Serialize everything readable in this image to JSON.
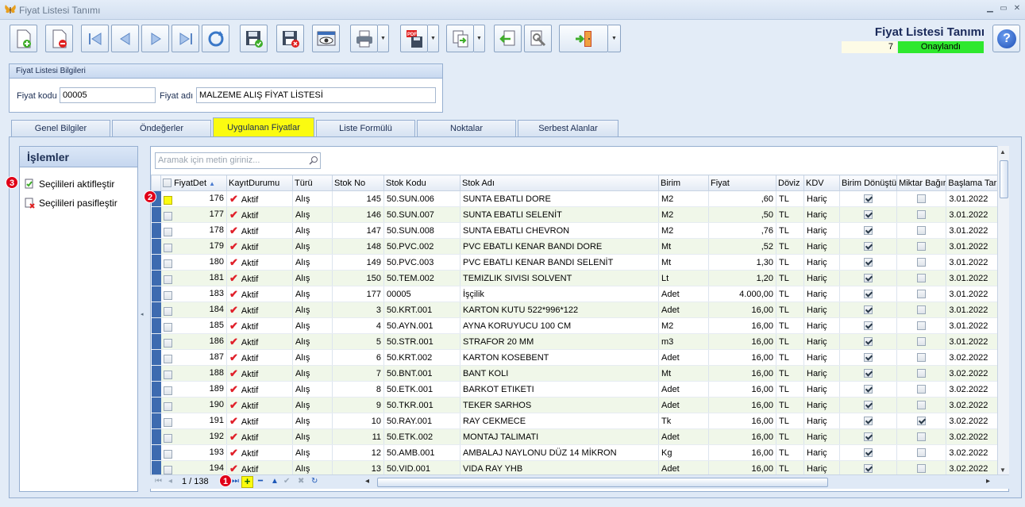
{
  "window": {
    "title": "Fiyat Listesi Tanımı"
  },
  "header": {
    "title": "Fiyat Listesi Tanımı",
    "number": "7",
    "status": "Onaylandı",
    "status_color": "#2ee82e"
  },
  "info": {
    "group_title": "Fiyat Listesi Bilgileri",
    "code_label": "Fiyat kodu",
    "code_value": "00005",
    "name_label": "Fiyat adı",
    "name_value": "MALZEME ALIŞ FİYAT LİSTESİ"
  },
  "tabs": [
    "Genel Bilgiler",
    "Öndeğerler",
    "Uygulanan Fiyatlar",
    "Liste Formülü",
    "Noktalar",
    "Serbest Alanlar"
  ],
  "active_tab": "Uygulanan Fiyatlar",
  "operations": {
    "title": "İşlemler",
    "items": [
      "Seçilileri aktifleştir",
      "Seçilileri pasifleştir"
    ]
  },
  "markers": [
    "1",
    "2",
    "3"
  ],
  "grid": {
    "search_placeholder": "Aramak için metin giriniz...",
    "columns": [
      "FiyatDet",
      "KayıtDurumu",
      "Türü",
      "Stok No",
      "Stok Kodu",
      "Stok Adı",
      "Birim",
      "Fiyat",
      "Döviz",
      "KDV",
      "Birim Dönüştü",
      "Miktar Bağır",
      "Başlama Tarihi"
    ],
    "rows": [
      {
        "id": "176",
        "status": "Aktif",
        "type": "Alış",
        "stok_no": "145",
        "stok_kodu": "50.SUN.006",
        "stok_adi": "SUNTA EBATLI DORE",
        "birim": "M2",
        "fiyat": ",60",
        "doviz": "TL",
        "kdv": "Hariç",
        "conv": true,
        "qty": false,
        "date": "3.01.2022"
      },
      {
        "id": "177",
        "status": "Aktif",
        "type": "Alış",
        "stok_no": "146",
        "stok_kodu": "50.SUN.007",
        "stok_adi": "SUNTA EBATLI SELENİT",
        "birim": "M2",
        "fiyat": ",50",
        "doviz": "TL",
        "kdv": "Hariç",
        "conv": true,
        "qty": false,
        "date": "3.01.2022"
      },
      {
        "id": "178",
        "status": "Aktif",
        "type": "Alış",
        "stok_no": "147",
        "stok_kodu": "50.SUN.008",
        "stok_adi": "SUNTA EBATLI CHEVRON",
        "birim": "M2",
        "fiyat": ",76",
        "doviz": "TL",
        "kdv": "Hariç",
        "conv": true,
        "qty": false,
        "date": "3.01.2022"
      },
      {
        "id": "179",
        "status": "Aktif",
        "type": "Alış",
        "stok_no": "148",
        "stok_kodu": "50.PVC.002",
        "stok_adi": "PVC EBATLI KENAR BANDI DORE",
        "birim": "Mt",
        "fiyat": ",52",
        "doviz": "TL",
        "kdv": "Hariç",
        "conv": true,
        "qty": false,
        "date": "3.01.2022"
      },
      {
        "id": "180",
        "status": "Aktif",
        "type": "Alış",
        "stok_no": "149",
        "stok_kodu": "50.PVC.003",
        "stok_adi": "PVC EBATLI KENAR BANDI SELENİT",
        "birim": "Mt",
        "fiyat": "1,30",
        "doviz": "TL",
        "kdv": "Hariç",
        "conv": true,
        "qty": false,
        "date": "3.01.2022"
      },
      {
        "id": "181",
        "status": "Aktif",
        "type": "Alış",
        "stok_no": "150",
        "stok_kodu": "50.TEM.002",
        "stok_adi": "TEMIZLIK SIVISI SOLVENT",
        "birim": "Lt",
        "fiyat": "1,20",
        "doviz": "TL",
        "kdv": "Hariç",
        "conv": true,
        "qty": false,
        "date": "3.01.2022"
      },
      {
        "id": "183",
        "status": "Aktif",
        "type": "Alış",
        "stok_no": "177",
        "stok_kodu": "00005",
        "stok_adi": "İşçilik",
        "birim": "Adet",
        "fiyat": "4.000,00",
        "doviz": "TL",
        "kdv": "Hariç",
        "conv": true,
        "qty": false,
        "date": "3.01.2022"
      },
      {
        "id": "184",
        "status": "Aktif",
        "type": "Alış",
        "stok_no": "3",
        "stok_kodu": "50.KRT.001",
        "stok_adi": "KARTON KUTU 522*996*122",
        "birim": "Adet",
        "fiyat": "16,00",
        "doviz": "TL",
        "kdv": "Hariç",
        "conv": true,
        "qty": false,
        "date": "3.01.2022"
      },
      {
        "id": "185",
        "status": "Aktif",
        "type": "Alış",
        "stok_no": "4",
        "stok_kodu": "50.AYN.001",
        "stok_adi": "AYNA KORUYUCU 100 CM",
        "birim": "M2",
        "fiyat": "16,00",
        "doviz": "TL",
        "kdv": "Hariç",
        "conv": true,
        "qty": false,
        "date": "3.01.2022"
      },
      {
        "id": "186",
        "status": "Aktif",
        "type": "Alış",
        "stok_no": "5",
        "stok_kodu": "50.STR.001",
        "stok_adi": "STRAFOR 20 MM",
        "birim": "m3",
        "fiyat": "16,00",
        "doviz": "TL",
        "kdv": "Hariç",
        "conv": true,
        "qty": false,
        "date": "3.01.2022"
      },
      {
        "id": "187",
        "status": "Aktif",
        "type": "Alış",
        "stok_no": "6",
        "stok_kodu": "50.KRT.002",
        "stok_adi": "KARTON KOSEBENT",
        "birim": "Adet",
        "fiyat": "16,00",
        "doviz": "TL",
        "kdv": "Hariç",
        "conv": true,
        "qty": false,
        "date": "3.02.2022"
      },
      {
        "id": "188",
        "status": "Aktif",
        "type": "Alış",
        "stok_no": "7",
        "stok_kodu": "50.BNT.001",
        "stok_adi": "BANT KOLI",
        "birim": "Mt",
        "fiyat": "16,00",
        "doviz": "TL",
        "kdv": "Hariç",
        "conv": true,
        "qty": false,
        "date": "3.02.2022"
      },
      {
        "id": "189",
        "status": "Aktif",
        "type": "Alış",
        "stok_no": "8",
        "stok_kodu": "50.ETK.001",
        "stok_adi": "BARKOT ETIKETI",
        "birim": "Adet",
        "fiyat": "16,00",
        "doviz": "TL",
        "kdv": "Hariç",
        "conv": true,
        "qty": false,
        "date": "3.02.2022"
      },
      {
        "id": "190",
        "status": "Aktif",
        "type": "Alış",
        "stok_no": "9",
        "stok_kodu": "50.TKR.001",
        "stok_adi": "TEKER SARHOS",
        "birim": "Adet",
        "fiyat": "16,00",
        "doviz": "TL",
        "kdv": "Hariç",
        "conv": true,
        "qty": false,
        "date": "3.02.2022"
      },
      {
        "id": "191",
        "status": "Aktif",
        "type": "Alış",
        "stok_no": "10",
        "stok_kodu": "50.RAY.001",
        "stok_adi": "RAY CEKMECE",
        "birim": "Tk",
        "fiyat": "16,00",
        "doviz": "TL",
        "kdv": "Hariç",
        "conv": true,
        "qty": true,
        "date": "3.02.2022"
      },
      {
        "id": "192",
        "status": "Aktif",
        "type": "Alış",
        "stok_no": "11",
        "stok_kodu": "50.ETK.002",
        "stok_adi": "MONTAJ TALIMATI",
        "birim": "Adet",
        "fiyat": "16,00",
        "doviz": "TL",
        "kdv": "Hariç",
        "conv": true,
        "qty": false,
        "date": "3.02.2022"
      },
      {
        "id": "193",
        "status": "Aktif",
        "type": "Alış",
        "stok_no": "12",
        "stok_kodu": "50.AMB.001",
        "stok_adi": "AMBALAJ NAYLONU DÜZ 14 MİKRON",
        "birim": "Kg",
        "fiyat": "16,00",
        "doviz": "TL",
        "kdv": "Hariç",
        "conv": true,
        "qty": false,
        "date": "3.02.2022"
      },
      {
        "id": "194",
        "status": "Aktif",
        "type": "Alış",
        "stok_no": "13",
        "stok_kodu": "50.VID.001",
        "stok_adi": "VIDA RAY YHB",
        "birim": "Adet",
        "fiyat": "16,00",
        "doviz": "TL",
        "kdv": "Hariç",
        "conv": true,
        "qty": false,
        "date": "3.02.2022"
      }
    ]
  },
  "navigator": {
    "page": "1 / 138"
  }
}
